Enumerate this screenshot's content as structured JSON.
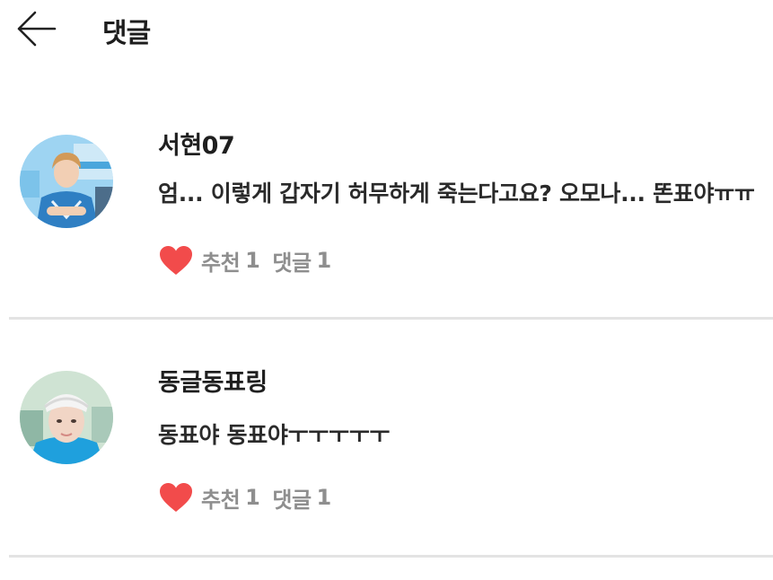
{
  "header": {
    "back_icon": "arrow-left-icon",
    "title": "댓글"
  },
  "comments": [
    {
      "author": "서현07",
      "text": "엄... 이렇게 갑자기 허무하게 죽는다고요? 오모나... 똔표야ㅠㅠ",
      "like_label": "추천",
      "like_count": "1",
      "reply_label": "댓글",
      "reply_count": "1",
      "like_icon": "heart-icon",
      "avatar_icon": "user-photo-avatar"
    },
    {
      "author": "동글동표링",
      "text": "동표야 동표야ㅜㅜㅜㅜㅜ",
      "like_label": "추천",
      "like_count": "1",
      "reply_label": "댓글",
      "reply_count": "1",
      "like_icon": "heart-icon",
      "avatar_icon": "user-photo-avatar"
    }
  ],
  "colors": {
    "heart": "#f24b4b",
    "meta_text": "#8e8e8e",
    "divider": "#e3e3e3"
  }
}
